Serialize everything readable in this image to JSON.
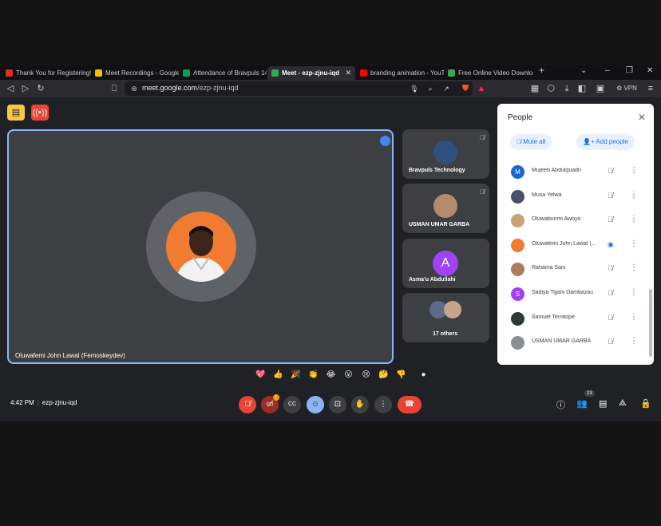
{
  "browser": {
    "tabs": [
      {
        "label": "Thank You for Registering! |",
        "color": "#d93025"
      },
      {
        "label": "Meet Recordings - Google D",
        "color": "#1a73e8"
      },
      {
        "label": "Attendance of Bravpuls 14d",
        "color": "#0f9d58"
      },
      {
        "label": "Meet - ezp-zjnu-iqd",
        "color": "#ea4335",
        "active": true
      },
      {
        "label": "branding animation - YouT",
        "color": "#ff0000"
      },
      {
        "label": "Free Online Video Downloa",
        "color": "#34a853"
      }
    ],
    "url_host": "meet.google.com",
    "url_path": "/ezp-zjnu-iqd",
    "vpn_label": "VPN"
  },
  "meeting": {
    "main_speaker": "Oluwafemi John Lawal (Femoskeydev)",
    "side_tiles": [
      "Bravpuls Technology",
      "USMAN UMAR GARBA",
      "Asma'u Abdullahi",
      "17 others"
    ],
    "tile_initial": "A",
    "time": "4:42 PM",
    "code": "ezp-zjnu-iqd",
    "participant_count": "23"
  },
  "people_panel": {
    "title": "People",
    "mute_all": "Mute all",
    "add_people": "Add people",
    "people": [
      {
        "name": "Mujeeb Abdulquadri",
        "initial": "M",
        "color": "#1967d2",
        "speaking": false
      },
      {
        "name": "Musa Yelwa",
        "initial": "",
        "color": "#4a4f6b",
        "speaking": false
      },
      {
        "name": "Oluwabunmi Awoyo",
        "initial": "",
        "color": "#c9a27a",
        "speaking": false
      },
      {
        "name": "Oluwafemi John Lawal (...",
        "initial": "",
        "color": "#f07b31",
        "speaking": true
      },
      {
        "name": "Rahama Sani",
        "initial": "",
        "color": "#b07b5a",
        "speaking": false
      },
      {
        "name": "Sadiya Tijjani Dambazau",
        "initial": "S",
        "color": "#a142f4",
        "speaking": false
      },
      {
        "name": "Samuel Temitope",
        "initial": "",
        "color": "#2d3b36",
        "speaking": false
      },
      {
        "name": "USMAN UMAR GARBA",
        "initial": "",
        "color": "#8b8f94",
        "speaking": false
      }
    ]
  },
  "reactions": [
    "💖",
    "👍",
    "🎉",
    "👏",
    "😂",
    "😮",
    "😢",
    "🤔",
    "👎"
  ],
  "icons": {
    "mic_off": "mic-off-icon",
    "cam_off": "camera-off-icon",
    "captions": "captions-icon",
    "emoji": "emoji-icon",
    "present": "present-icon",
    "hand": "raise-hand-icon",
    "more": "more-vert-icon",
    "end": "end-call-icon"
  },
  "colors": {
    "accent": "#8ab4f8",
    "danger": "#ea4335",
    "panel": "#ffffff"
  }
}
